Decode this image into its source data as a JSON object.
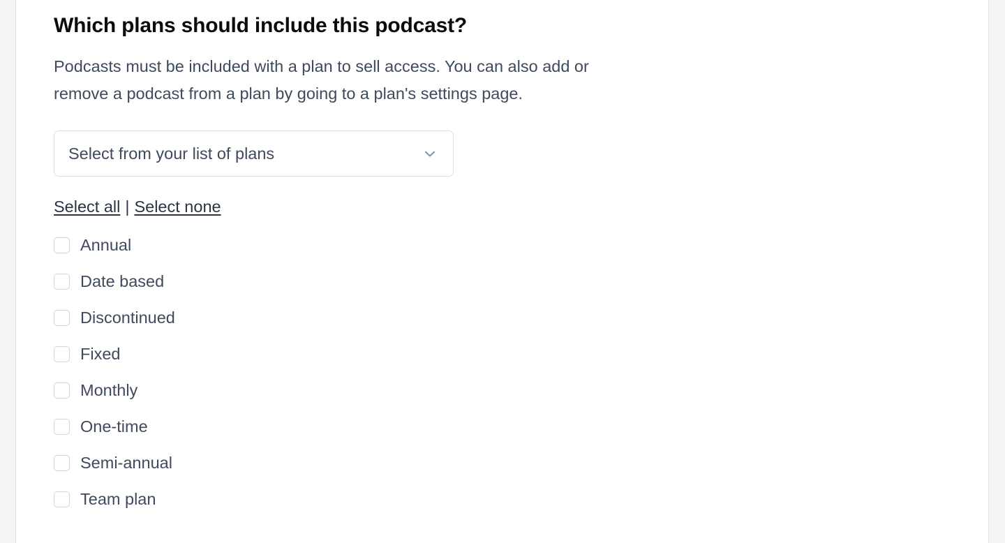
{
  "panel": {
    "heading": "Which plans should include this podcast?",
    "description": "Podcasts must be included with a plan to sell access. You can also add or remove a podcast from a plan by going to a plan's settings page."
  },
  "plan_select": {
    "placeholder": "Select from your list of plans",
    "value": "Select from your list of plans",
    "icon": "chevron-down-icon"
  },
  "bulk_actions": {
    "select_all_label": "Select all",
    "separator": "|",
    "select_none_label": "Select none"
  },
  "plans": [
    {
      "label": "Annual",
      "checked": false
    },
    {
      "label": "Date based",
      "checked": false
    },
    {
      "label": "Discontinued",
      "checked": false
    },
    {
      "label": "Fixed",
      "checked": false
    },
    {
      "label": "Monthly",
      "checked": false
    },
    {
      "label": "One-time",
      "checked": false
    },
    {
      "label": "Semi-annual",
      "checked": false
    },
    {
      "label": "Team plan",
      "checked": false
    }
  ],
  "colors": {
    "page_background": "#f4f4f5",
    "panel_background": "#ffffff",
    "panel_border": "#dfe3e8",
    "heading_text": "#0b0c0d",
    "body_text": "#3f4a5c",
    "link_text": "#2b3445",
    "control_border": "#dcdfe3",
    "checkbox_border": "#cdd7e2",
    "chevron": "#8d99ae"
  }
}
